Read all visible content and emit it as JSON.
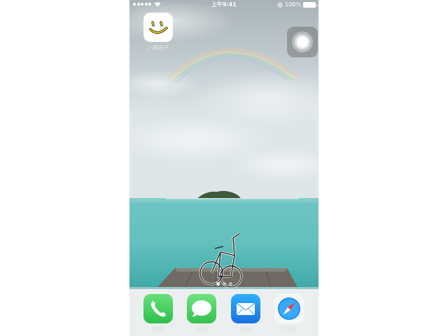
{
  "status_bar": {
    "time": "上午9:41",
    "battery": "100%"
  },
  "home_apps": [
    {
      "label": "小贼音乐",
      "icon": "smiley-icon"
    }
  ],
  "dock_apps": [
    {
      "label": "电话",
      "icon": "phone-icon"
    },
    {
      "label": "信息",
      "icon": "messages-icon"
    },
    {
      "label": "邮件",
      "icon": "mail-icon"
    },
    {
      "label": "Safari",
      "icon": "safari-compass-icon"
    }
  ],
  "page_indicator": {
    "pages": 3,
    "current": 1
  },
  "colors": {
    "phone_green": "#4cd964",
    "mail_blue": "#1e88f0",
    "smiley_yellow": "#f5d800"
  }
}
